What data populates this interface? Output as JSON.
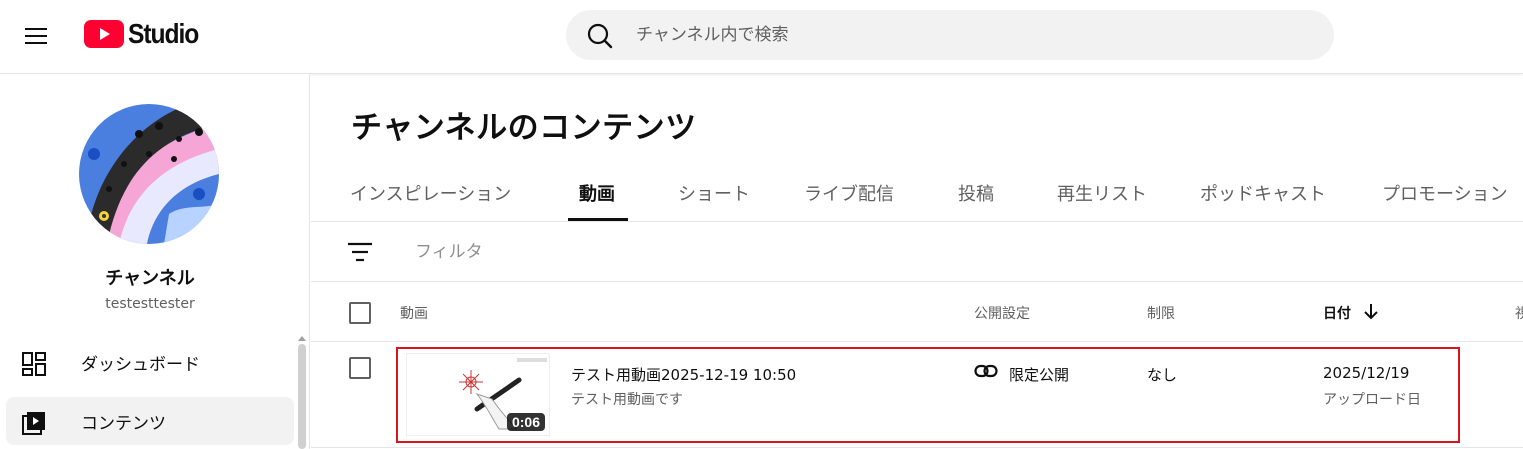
{
  "header": {
    "logo_text": "Studio",
    "search_placeholder": "チャンネル内で検索"
  },
  "sidebar": {
    "channel_name": "チャンネル",
    "channel_handle": "testesttester",
    "items": [
      {
        "label": "ダッシュボード",
        "icon": "dashboard-icon"
      },
      {
        "label": "コンテンツ",
        "icon": "content-icon",
        "active": true
      }
    ]
  },
  "main": {
    "title": "チャンネルのコンテンツ",
    "tabs": [
      {
        "label": "インスピレーション"
      },
      {
        "label": "動画",
        "active": true
      },
      {
        "label": "ショート"
      },
      {
        "label": "ライブ配信"
      },
      {
        "label": "投稿"
      },
      {
        "label": "再生リスト"
      },
      {
        "label": "ポッドキャスト"
      },
      {
        "label": "プロモーション"
      }
    ],
    "filter_placeholder": "フィルタ",
    "columns": {
      "video": "動画",
      "visibility": "公開設定",
      "restrictions": "制限",
      "date": "日付",
      "views_partial": "視"
    },
    "rows": [
      {
        "title": "テスト用動画2025-12-19 10:50",
        "description": "テスト用動画です",
        "duration": "0:06",
        "visibility": "限定公開",
        "restrictions": "なし",
        "date": "2025/12/19",
        "date_type": "アップロード日"
      }
    ]
  },
  "colors": {
    "brand_red": "#ff0033",
    "highlight_border": "#d9141a",
    "text_primary": "#0f0f0f",
    "text_secondary": "#606060"
  }
}
